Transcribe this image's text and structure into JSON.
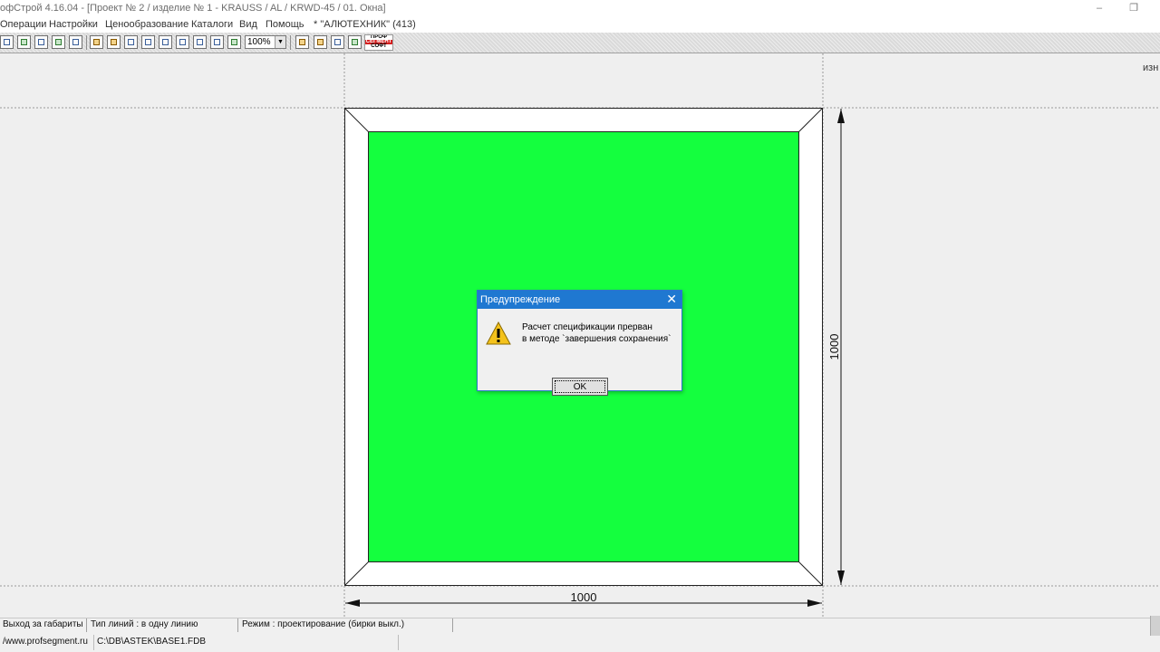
{
  "window": {
    "title": "офСтрой 4.16.04 - [Проект № 2 / изделие № 1  -  KRAUSS / AL / KRWD-45 / 01. Окна]",
    "minimize_glyph": "–",
    "restore_glyph": "❐"
  },
  "menu": {
    "items": [
      "Операции",
      "Настройки",
      "Ценообразование",
      "Каталоги",
      "Вид",
      "Помощь"
    ],
    "company": "* \"АЛЮТЕХНИК\" (413)"
  },
  "toolbar": {
    "zoom": "100%",
    "logo_line1": "ПРОФ",
    "logo_line2": "СЕГМЕНТ",
    "logo_line3": "СОФТ"
  },
  "canvas": {
    "corner_text": "изн",
    "width_dimension": "1000",
    "height_dimension": "1000",
    "glass_color": "#14ff3e"
  },
  "dialog": {
    "title": "Предупреждение",
    "close_glyph": "✕",
    "message_line1": "Расчет спецификации прерван",
    "message_line2": "в методе `завершения сохранения`",
    "ok_label": "OK",
    "icon": "warning-icon"
  },
  "status": {
    "cell1": "Выход за габариты",
    "cell2": "Тип линий : в одну линию",
    "cell3": "Режим : проектирование  (бирки выкл.)",
    "website": "/www.profsegment.ru",
    "db_path": "C:\\DB\\ASTEK\\BASE1.FDB"
  }
}
